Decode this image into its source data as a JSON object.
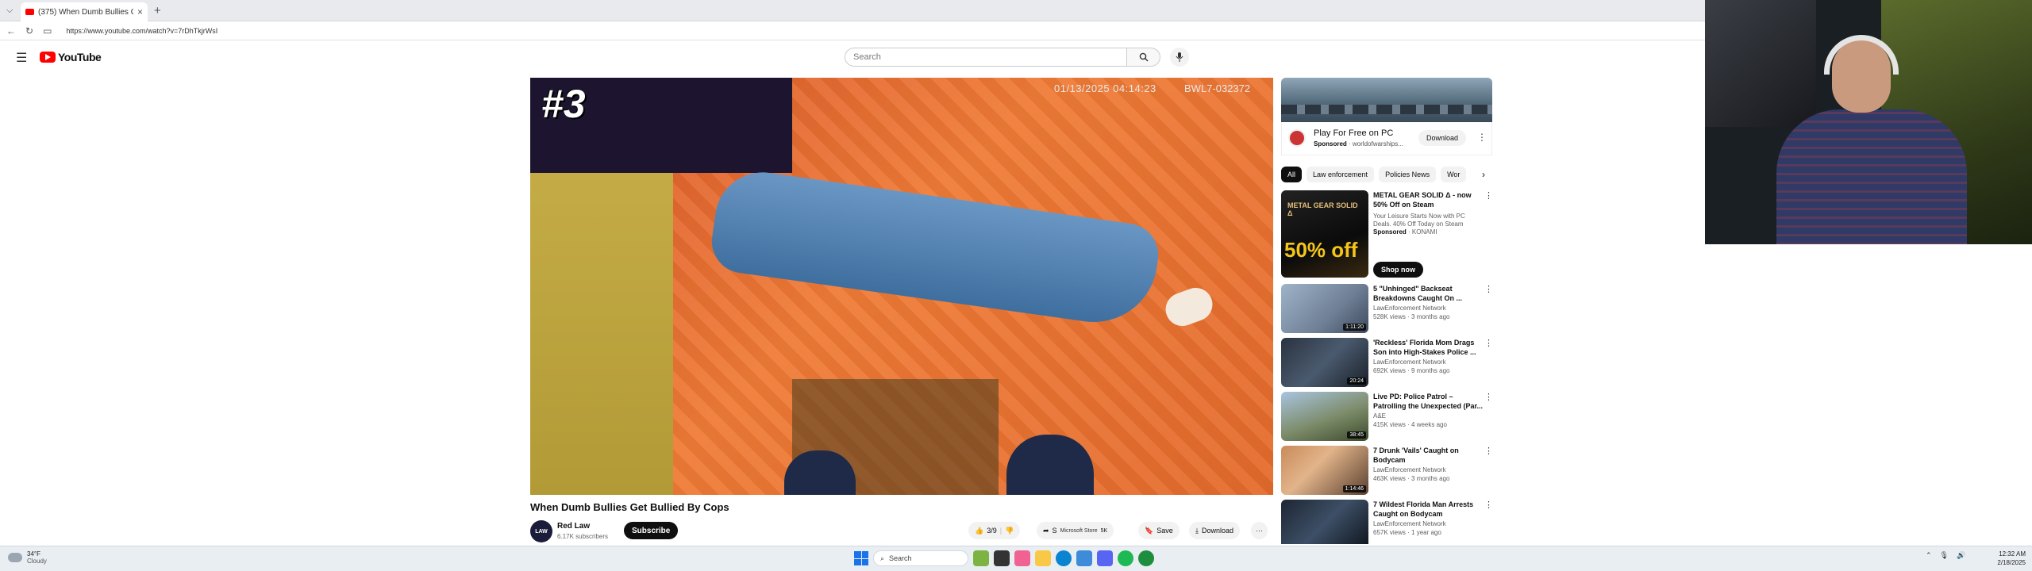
{
  "browser": {
    "tab_title": "(375) When Dumb Bullies Get...",
    "tab_close": "×",
    "new_tab": "+",
    "url": "https://www.youtube.com/watch?v=7rDhTkjrWsI"
  },
  "youtube": {
    "logo_text": "YouTube",
    "search_placeholder": "Search"
  },
  "video": {
    "overlay_rank": "#3",
    "overlay_timestamp": "01/13/2025 04:14:23",
    "overlay_device": "BWL7-032372",
    "title": "When Dumb Bullies Get Bullied By Cops",
    "channel_name": "Red Law",
    "channel_avatar_text": "LAW",
    "channel_subs": "6.17K subscribers",
    "subscribe_label": "Subscribe",
    "likes": "3/9",
    "share_label": "S",
    "share_tooltip": "Microsoft Store",
    "share_count": "5K",
    "save_label": "Save",
    "download_label": "Download"
  },
  "ad": {
    "title": "Play For Free on PC",
    "sponsored": "Sponsored",
    "domain": "· worldofwarships...",
    "download_label": "Download"
  },
  "chips": [
    "All",
    "Law enforcement",
    "Policies News",
    "Wor"
  ],
  "recommendations": [
    {
      "title": "METAL GEAR SOLID Δ - now 50% Off on Steam",
      "line2": "Your Leisure Starts Now with PC Deals. 40% Off Today on Steam",
      "sponsored": "Sponsored",
      "advertiser": "· KONAMI",
      "shop_label": "Shop now",
      "thumb_text": "50% off",
      "thumb_top": "METAL GEAR SOLID Δ"
    },
    {
      "title": "5 \"Unhinged\" Backseat Breakdowns Caught On ...",
      "channel": "LawEnforcement Network",
      "meta": "528K views · 3 months ago",
      "duration": "1:11:20"
    },
    {
      "title": "'Reckless' Florida Mom Drags Son into High-Stakes Police ...",
      "channel": "LawEnforcement Network",
      "meta": "692K views · 9 months ago",
      "duration": "20:24"
    },
    {
      "title": "Live PD: Police Patrol – Patrolling the Unexpected (Par...",
      "channel": "A&E",
      "meta": "415K views · 4 weeks ago",
      "duration": "38:45"
    },
    {
      "title": "7 Drunk 'Vails' Caught on Bodycam",
      "channel": "LawEnforcement Network",
      "meta": "463K views · 3 months ago",
      "duration": "1:14:46"
    },
    {
      "title": "7 Wildest Florida Man Arrests Caught on Bodycam",
      "channel": "LawEnforcement Network",
      "meta": "657K views · 1 year ago",
      "duration": ""
    }
  ],
  "taskbar": {
    "weather_temp": "34°F",
    "weather_cond": "Cloudy",
    "search_label": "Search",
    "time": "12:32 AM",
    "date": "2/18/2025"
  },
  "colors": {
    "youtube_red": "#ff0000",
    "subscribe_bg": "#0f0f0f",
    "windows_blue": "#1a73e8"
  }
}
